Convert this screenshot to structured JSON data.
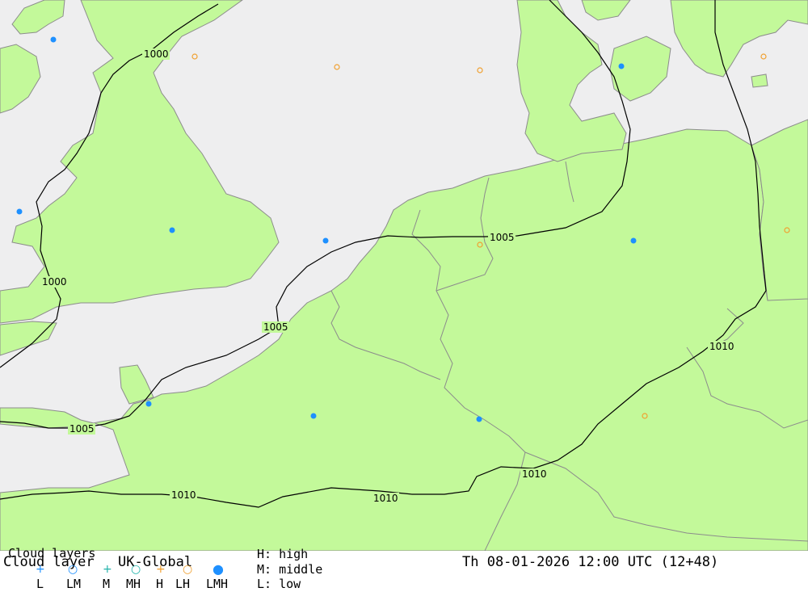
{
  "map": {
    "colors": {
      "sea": "#eeeeef",
      "land": "#c3f99a",
      "border": "#8c8c8c",
      "isobar": "#000000",
      "cloud_full": "#1e90ff",
      "cloud_high": "#f0a030",
      "cloud_low": "#1e90ff"
    },
    "isobar_labels": [
      "1000",
      "1000",
      "1005",
      "1005",
      "1005",
      "1010",
      "1010",
      "1010",
      "1010"
    ],
    "station_marker_legend": "LMH = filled blue dot, H = orange ring"
  },
  "legend": {
    "title_line1": "Cloud layers",
    "title_line2": "Cloud layer",
    "model": "UK-Global",
    "codes": [
      "L",
      "LM",
      "M",
      "MH",
      "H",
      "LH",
      "LMH"
    ],
    "key_high": "H: high",
    "key_middle": "M: middle",
    "key_low": "L: low",
    "datetime": "Th 08-01-2026 12:00 UTC (12+48)"
  }
}
